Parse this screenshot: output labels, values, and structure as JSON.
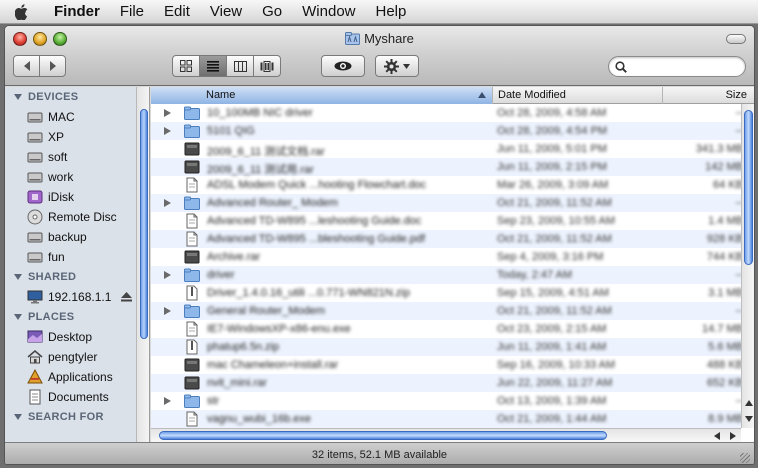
{
  "menubar": {
    "apple_icon": "apple-icon",
    "app_name": "Finder",
    "items": [
      "File",
      "Edit",
      "View",
      "Go",
      "Window",
      "Help"
    ]
  },
  "window": {
    "title": "Myshare",
    "title_icon": "shared-folder-icon"
  },
  "toolbar": {
    "back_icon": "chevron-left-icon",
    "forward_icon": "chevron-right-icon",
    "view_modes": [
      "icon-view",
      "list-view",
      "column-view",
      "cover-flow-view"
    ],
    "active_view": "list-view",
    "quicklook_icon": "eye-icon",
    "action_icon": "gear-icon",
    "search": {
      "value": "",
      "placeholder": ""
    }
  },
  "sidebar": {
    "sections": [
      {
        "title": "DEVICES",
        "items": [
          {
            "label": "MAC",
            "icon": "hard-drive-icon"
          },
          {
            "label": "XP",
            "icon": "hard-drive-icon"
          },
          {
            "label": "soft",
            "icon": "hard-drive-icon"
          },
          {
            "label": "work",
            "icon": "hard-drive-icon"
          },
          {
            "label": "iDisk",
            "icon": "idisk-icon"
          },
          {
            "label": "Remote Disc",
            "icon": "disc-icon"
          },
          {
            "label": "backup",
            "icon": "hard-drive-icon"
          },
          {
            "label": "fun",
            "icon": "hard-drive-icon"
          }
        ]
      },
      {
        "title": "SHARED",
        "items": [
          {
            "label": "192.168.1.1",
            "icon": "network-computer-icon",
            "eject": true
          }
        ]
      },
      {
        "title": "PLACES",
        "items": [
          {
            "label": "Desktop",
            "icon": "desktop-icon"
          },
          {
            "label": "pengtyler",
            "icon": "home-icon"
          },
          {
            "label": "Applications",
            "icon": "applications-icon"
          },
          {
            "label": "Documents",
            "icon": "documents-icon"
          }
        ]
      },
      {
        "title": "SEARCH FOR",
        "items": []
      }
    ]
  },
  "filelist": {
    "columns": {
      "name": "Name",
      "date": "Date Modified",
      "size": "Size"
    },
    "sort_column": "name",
    "rows": [
      {
        "kind": "folder",
        "name": "10_100MB NIC driver",
        "date": "Oct 28, 2009, 4:58 AM",
        "size": "--"
      },
      {
        "kind": "folder",
        "name": "5101 QIG",
        "date": "Oct 28, 2009, 4:54 PM",
        "size": "--"
      },
      {
        "kind": "archive",
        "name": "2009_6_11 测试文档.rar",
        "date": "Jun 11, 2009, 5:01 PM",
        "size": "341.3 MB"
      },
      {
        "kind": "archive",
        "name": "2009_6_11 测试用.rar",
        "date": "Jun 11, 2009, 2:15 PM",
        "size": "142 MB"
      },
      {
        "kind": "document",
        "name": "ADSL Modem Quick ...hooting Flowchart.doc",
        "date": "Mar 26, 2009, 3:09 AM",
        "size": "64 KB"
      },
      {
        "kind": "folder",
        "name": "Advanced Router_ Modem",
        "date": "Oct 21, 2009, 11:52 AM",
        "size": "--"
      },
      {
        "kind": "document",
        "name": "Advanced TD-W895 ...leshooting Guide.doc",
        "date": "Sep 23, 2009, 10:55 AM",
        "size": "1.4 MB"
      },
      {
        "kind": "document",
        "name": "Advanced TD-W895 ...bleshooting Guide.pdf",
        "date": "Oct 21, 2009, 11:52 AM",
        "size": "928 KB"
      },
      {
        "kind": "archive",
        "name": "Archive.rar",
        "date": "Sep 4, 2009, 3:16 PM",
        "size": "744 KB"
      },
      {
        "kind": "folder",
        "name": "driver",
        "date": "Today, 2:47 AM",
        "size": "--"
      },
      {
        "kind": "zip",
        "name": "Driver_1.4.0.16_utili ...0.771-WN821N.zip",
        "date": "Sep 15, 2009, 4:51 AM",
        "size": "3.1 MB"
      },
      {
        "kind": "folder",
        "name": "General Router_Modem",
        "date": "Oct 21, 2009, 11:52 AM",
        "size": "--"
      },
      {
        "kind": "document",
        "name": "IE7-WindowsXP-x86-enu.exe",
        "date": "Oct 23, 2009, 2:15 AM",
        "size": "14.7 MB"
      },
      {
        "kind": "zip",
        "name": "phatup6.5n.zip",
        "date": "Jun 11, 2009, 1:41 AM",
        "size": "5.6 MB"
      },
      {
        "kind": "archive",
        "name": "mac Chameleon+install.rar",
        "date": "Sep 16, 2009, 10:33 AM",
        "size": "488 KB"
      },
      {
        "kind": "archive",
        "name": "nvit_mini.rar",
        "date": "Jun 22, 2009, 11:27 AM",
        "size": "652 KB"
      },
      {
        "kind": "folder",
        "name": "str",
        "date": "Oct 13, 2009, 1:39 AM",
        "size": "--"
      },
      {
        "kind": "document",
        "name": "vagnu_wubi_16b.exe",
        "date": "Oct 21, 2009, 1:44 AM",
        "size": "8.9 MB"
      }
    ]
  },
  "statusbar": {
    "text": "32 items, 52.1 MB available"
  },
  "colors": {
    "selected_column": "#8fb4e5",
    "scroll_thumb": "#6f9ee8",
    "sidebar_bg": "#dbe1e9",
    "row_stripe": "#edf3fe"
  }
}
